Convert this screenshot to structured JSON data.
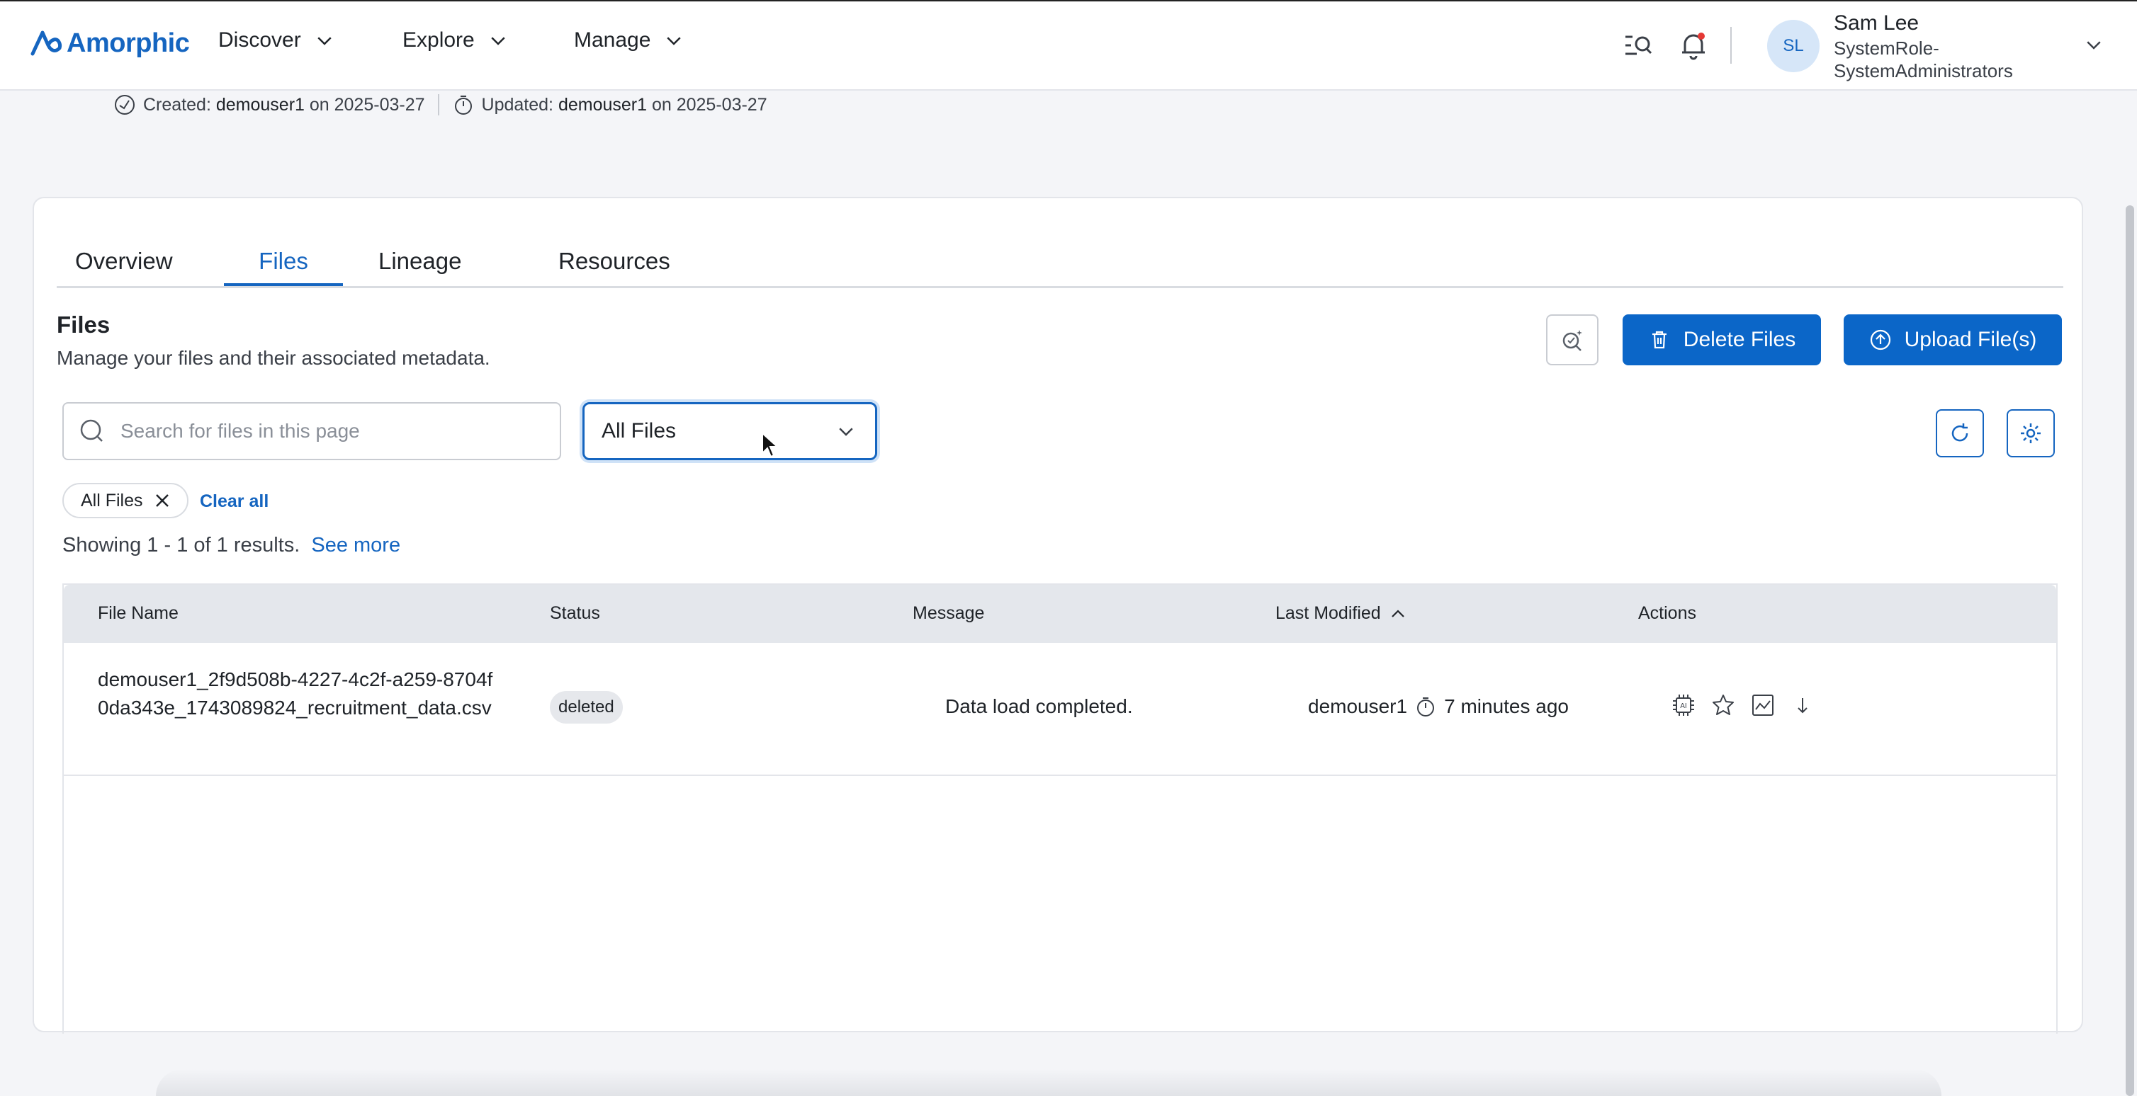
{
  "app": {
    "logo_text": "Amorphic",
    "brand_color": "#1565c0"
  },
  "nav": {
    "items": [
      {
        "label": "Discover",
        "icon": "chevron-down-icon"
      },
      {
        "label": "Explore",
        "icon": "chevron-down-icon"
      },
      {
        "label": "Manage",
        "icon": "chevron-down-icon"
      }
    ]
  },
  "header": {
    "icons": [
      "search-list-icon",
      "notification-bell-icon"
    ],
    "user": {
      "initials": "SL",
      "name": "Sam Lee",
      "role": "SystemRole-SystemAdministrators"
    }
  },
  "meta": {
    "created_prefix": "Created:",
    "created_by": "demouser1",
    "created_on": "on 2025-03-27",
    "updated_prefix": "Updated:",
    "updated_by": "demouser1",
    "updated_on": "on 2025-03-27"
  },
  "tabs": [
    {
      "label": "Overview",
      "active": false
    },
    {
      "label": "Files",
      "active": true
    },
    {
      "label": "Lineage",
      "active": false
    },
    {
      "label": "Resources",
      "active": false
    }
  ],
  "files_section": {
    "title": "Files",
    "description": "Manage your files and their associated metadata.",
    "delete_button": "Delete Files",
    "upload_button": "Upload File(s)",
    "search_placeholder": "Search for files in this page",
    "filter_value": "All Files",
    "active_chip": "All Files",
    "clear_all": "Clear all",
    "showing_text": "Showing 1 - 1 of 1 results.",
    "see_more": "See more"
  },
  "table": {
    "columns": [
      "File Name",
      "Status",
      "Message",
      "Last Modified",
      "Actions"
    ],
    "sort_indicator": "ascending",
    "rows": [
      {
        "file_name": "demouser1_2f9d508b-4227-4c2f-a259-8704f0da343e_1743089824_recruitment_data.csv",
        "status": "deleted",
        "message": "Data load completed.",
        "modified_by": "demouser1",
        "modified_ago": "7 minutes ago",
        "actions": [
          "ai-chip-icon",
          "star-icon",
          "chart-icon",
          "download-arrow-icon"
        ]
      }
    ]
  }
}
